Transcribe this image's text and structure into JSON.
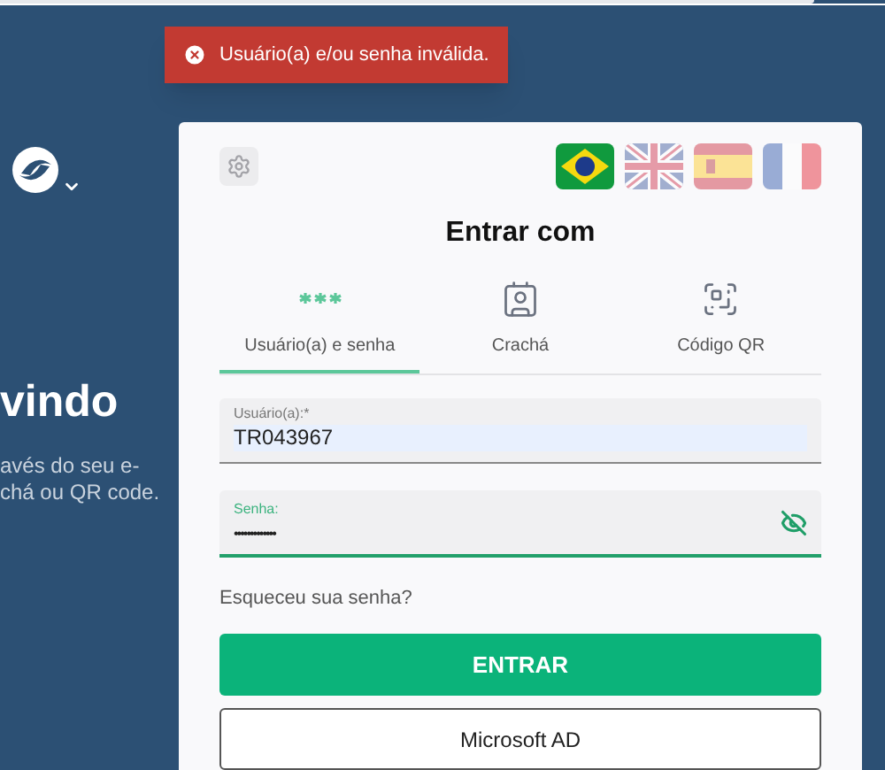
{
  "toast": {
    "message": "Usuário(a) e/ou senha inválida."
  },
  "welcome": {
    "title": "vindo",
    "lines": [
      "avés do seu e-",
      "chá ou QR code."
    ]
  },
  "languages": [
    {
      "kind": "br",
      "selected": true
    },
    {
      "kind": "uk",
      "selected": false
    },
    {
      "kind": "es",
      "selected": false
    },
    {
      "kind": "fr",
      "selected": false
    }
  ],
  "login": {
    "title": "Entrar com",
    "tabs": [
      {
        "kind": "password",
        "label": "Usuário(a) e senha",
        "selected": true
      },
      {
        "kind": "badge",
        "label": "Crachá",
        "selected": false
      },
      {
        "kind": "qr",
        "label": "Código QR",
        "selected": false
      }
    ],
    "username": {
      "label": "Usuário(a):*",
      "value": "TR043967"
    },
    "password": {
      "label": "Senha:",
      "value": "•••••••••••••",
      "focused": true
    },
    "forgot_link": "Esqueceu sua senha?",
    "buttons": [
      {
        "kind": "primary",
        "label": "ENTRAR"
      },
      {
        "kind": "outline",
        "label": "Microsoft AD"
      }
    ]
  }
}
